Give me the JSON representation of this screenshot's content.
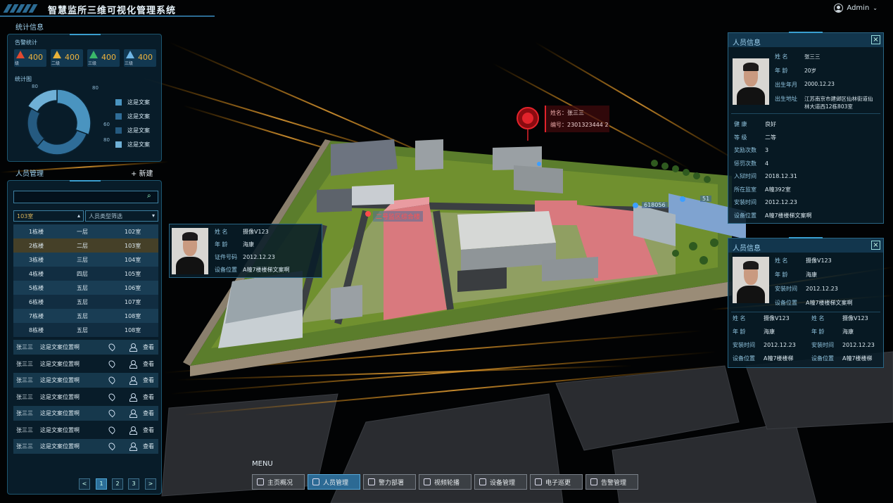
{
  "app_title": "智慧监所三维可视化管理系统",
  "user": {
    "name": "Admin",
    "dropdown_icon": "chevron-down-icon"
  },
  "stats": {
    "title": "统计信息",
    "alarm_title": "告警统计",
    "alarms": [
      {
        "level": "级",
        "count": "400",
        "color": "#e04a30"
      },
      {
        "level": "二级",
        "count": "400",
        "color": "#e8b23a"
      },
      {
        "level": "三级",
        "count": "400",
        "color": "#3ab86a"
      },
      {
        "level": "三级",
        "count": "400",
        "color": "#6fb6e6"
      }
    ],
    "chart_title": "统计图",
    "chart_data": {
      "type": "pie",
      "labels": [
        "这是文案",
        "这是文案",
        "这是文案",
        "这是文案"
      ],
      "values": [
        80,
        80,
        60,
        80
      ],
      "value_labels": [
        "80",
        "80",
        "60",
        "80"
      ],
      "colors": [
        "#4a94c0",
        "#2f6d98",
        "#255a80",
        "#6fb0d6"
      ]
    },
    "legend": [
      "这是文案",
      "这是文案",
      "这是文案",
      "这是文案"
    ]
  },
  "mgmt": {
    "title": "人员管理",
    "add_label": "+ 新建",
    "search_placeholder": "",
    "filter_room": "103室",
    "filter_type": "人员类型筛选",
    "rooms": [
      [
        "1栋楼",
        "一层",
        "102室"
      ],
      [
        "2栋楼",
        "二层",
        "103室"
      ],
      [
        "3栋楼",
        "三层",
        "104室"
      ],
      [
        "4栋楼",
        "四层",
        "105室"
      ],
      [
        "5栋楼",
        "五层",
        "106室"
      ],
      [
        "6栋楼",
        "五层",
        "107室"
      ],
      [
        "7栋楼",
        "五层",
        "108室"
      ],
      [
        "8栋楼",
        "五层",
        "108室"
      ]
    ],
    "list": [
      {
        "name": "张三三",
        "desc": "这是文案位置啊",
        "action": "查看"
      },
      {
        "name": "张三三",
        "desc": "这是文案位置啊",
        "action": "查看"
      },
      {
        "name": "张三三",
        "desc": "这是文案位置啊",
        "action": "查看"
      },
      {
        "name": "张三三",
        "desc": "这是文案位置啊",
        "action": "查看"
      },
      {
        "name": "张三三",
        "desc": "这是文案位置啊",
        "action": "查看"
      },
      {
        "name": "张三三",
        "desc": "这是文案位置啊",
        "action": "查看"
      },
      {
        "name": "张三三",
        "desc": "这是文案位置啊",
        "action": "查看"
      }
    ],
    "pages": [
      "1",
      "2",
      "3"
    ],
    "prev": "<",
    "next": ">"
  },
  "alarm_popup": {
    "name_label": "姓名",
    "name": "张三三",
    "id_label": "编号",
    "id": "2301323444 2"
  },
  "scene_labels": {
    "building_tag": "二号监区综合楼",
    "count1": "618056",
    "count2": "51"
  },
  "camera_popup": {
    "rows": [
      {
        "k": "姓    名",
        "v": "摄像V123"
      },
      {
        "k": "年    龄",
        "v": "海康"
      },
      {
        "k": "证件号码",
        "v": "2012.12.23"
      },
      {
        "k": "设备位置",
        "v": "A幢7楼楼梯文案啊"
      }
    ]
  },
  "person_info": {
    "title": "人员信息",
    "close": "×",
    "top_rows": [
      {
        "k": "姓    名",
        "v": "张三三"
      },
      {
        "k": "年    龄",
        "v": "20岁"
      },
      {
        "k": "出生年月",
        "v": "2000.12.23"
      },
      {
        "k": "出生地址",
        "v": "江苏南京市建邺区仙林街道仙林大道西12栋803室"
      }
    ],
    "rows": [
      {
        "k": "健    康",
        "v": "良好"
      },
      {
        "k": "等    级",
        "v": "二等"
      },
      {
        "k": "奖励次数",
        "v": "3"
      },
      {
        "k": "惩罚次数",
        "v": "4"
      },
      {
        "k": "入狱时间",
        "v": "2018.12.31"
      },
      {
        "k": "所在监室",
        "v": "A幢392室"
      },
      {
        "k": "安装时间",
        "v": "2012.12.23"
      },
      {
        "k": "设备位置",
        "v": "A幢7楼楼梯文案啊"
      }
    ]
  },
  "device_info": {
    "title": "人员信息",
    "close": "×",
    "top_rows": [
      {
        "k": "姓    名",
        "v": "摄像V123"
      },
      {
        "k": "年    龄",
        "v": "海康"
      },
      {
        "k": "安装时间",
        "v": "2012.12.23"
      },
      {
        "k": "设备位置",
        "v": "A幢7楼楼梯文案啊"
      }
    ],
    "grid": [
      [
        {
          "k": "姓    名",
          "v": "摄像V123"
        },
        {
          "k": "姓    名",
          "v": "摄像V123"
        }
      ],
      [
        {
          "k": "年    龄",
          "v": "海康"
        },
        {
          "k": "年    龄",
          "v": "海康"
        }
      ],
      [
        {
          "k": "安装时间",
          "v": "2012.12.23"
        },
        {
          "k": "安装时间",
          "v": "2012.12.23"
        }
      ],
      [
        {
          "k": "设备位置",
          "v": "A幢7楼楼梯"
        },
        {
          "k": "设备位置",
          "v": "A幢7楼楼梯"
        }
      ]
    ]
  },
  "menu": {
    "label": "MENU",
    "items": [
      "主页概况",
      "人员管理",
      "警力部署",
      "视频轮播",
      "设备管理",
      "电子巡更",
      "告警管理"
    ],
    "active_index": 1
  }
}
